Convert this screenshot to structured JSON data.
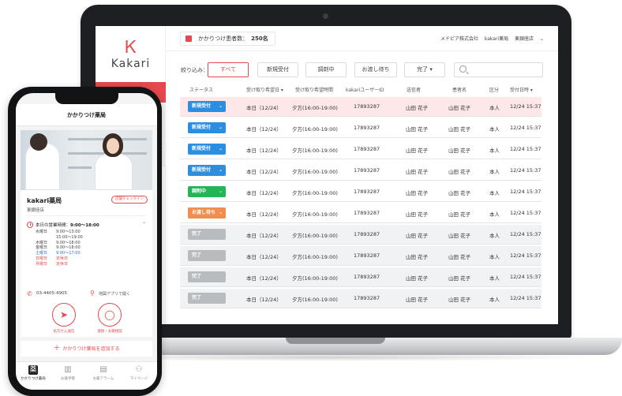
{
  "laptop": {
    "logo_text": "Kakari",
    "header": {
      "count_label": "かかりつけ患者数：",
      "count_value": "250名",
      "company": "メドピア株式会社",
      "store": "kakari薬局",
      "branch": "東銀座店",
      "branch_caret": "⌄"
    },
    "filter": {
      "label": "絞り込み：",
      "buttons": [
        "すべて",
        "新規受付",
        "調剤中",
        "お渡し待ち",
        "完了 ▾"
      ]
    },
    "table": {
      "headers": [
        "ステータス",
        "受け取り希望日 ▾",
        "受け取り希望時間",
        "kakariユーザーID",
        "送信者",
        "患者名",
        "区分",
        "受付日時 ▾"
      ],
      "rows": [
        {
          "status": "新規受付",
          "date": "本日（12/24）",
          "time": "夕方(16:00-19:00)",
          "id": "17893287",
          "sender": "山田 花子",
          "patient": "山田 花子",
          "kind": "本人",
          "received": "12/24 15:37"
        },
        {
          "status": "新規受付",
          "date": "本日（12/24）",
          "time": "夕方(16:00-19:00)",
          "id": "17893287",
          "sender": "山田 花子",
          "patient": "山田 花子",
          "kind": "本人",
          "received": "12/24 15:37"
        },
        {
          "status": "新規受付",
          "date": "本日（12/24）",
          "time": "夕方(16:00-19:00)",
          "id": "17893287",
          "sender": "山田 花子",
          "patient": "山田 花子",
          "kind": "本人",
          "received": "12/24 15:37"
        },
        {
          "status": "新規受付",
          "date": "本日（12/24）",
          "time": "夕方(16:00-19:00)",
          "id": "17893287",
          "sender": "山田 花子",
          "patient": "山田 花子",
          "kind": "本人",
          "received": "12/24 15:37"
        },
        {
          "status": "調剤中",
          "date": "本日（12/24）",
          "time": "夕方(16:00-19:00)",
          "id": "17893287",
          "sender": "山田 花子",
          "patient": "山田 花子",
          "kind": "本人",
          "received": "12/24 15:37"
        },
        {
          "status": "お渡し待ち",
          "date": "本日（12/24）",
          "time": "夕方(16:00-19:00)",
          "id": "17893287",
          "sender": "山田 花子",
          "patient": "山田 花子",
          "kind": "本人",
          "received": "12/24 15:37"
        },
        {
          "status": "完了",
          "date": "本日（12/24）",
          "time": "夕方(16:00-19:00)",
          "id": "17893287",
          "sender": "山田 花子",
          "patient": "山田 花子",
          "kind": "本人",
          "received": "12/24 15:37"
        },
        {
          "status": "完了",
          "date": "本日（12/24）",
          "time": "夕方(16:00-19:00)",
          "id": "17893287",
          "sender": "山田 花子",
          "patient": "山田 花子",
          "kind": "本人",
          "received": "12/24 15:37"
        },
        {
          "status": "完了",
          "date": "本日（12/24）",
          "time": "夕方(16:00-19:00)",
          "id": "17893287",
          "sender": "山田 花子",
          "patient": "山田 花子",
          "kind": "本人",
          "received": "12/24 15:37"
        },
        {
          "status": "完了",
          "date": "本日（12/24）",
          "time": "夕方(16:00-19:00)",
          "id": "17893287",
          "sender": "山田 花子",
          "patient": "山田 花子",
          "kind": "本人",
          "received": "12/24 15:37"
        }
      ]
    }
  },
  "phone": {
    "header_title": "かかりつけ薬局",
    "store_name": "kakari薬局",
    "branch": "東銀座店",
    "badge": "店舗チェックイン",
    "today_label": "本日の営業時間：",
    "today_hours": "9:00～18:00",
    "hours": [
      {
        "day": "水曜日",
        "time": "9:00～13:00",
        "style": "normal"
      },
      {
        "day": "",
        "time": "15:00～19:00",
        "style": "normal"
      },
      {
        "day": "木曜日",
        "time": "9:00～18:00",
        "style": "normal"
      },
      {
        "day": "金曜日",
        "time": "9:00～18:00",
        "style": "normal"
      },
      {
        "day": "土曜日",
        "time": "9:00～17:00",
        "style": "blue"
      },
      {
        "day": "日曜日",
        "time": "定休日",
        "style": "red"
      },
      {
        "day": "月曜日",
        "time": "定休日",
        "style": "red"
      }
    ],
    "phone_number": "03-4405-4905",
    "map_label": "地図アプリで開く",
    "action_send": "処方せん送信",
    "action_contact": "連絡・お薬相談",
    "add_store": "かかりつけ薬局を追加する",
    "tabs": [
      "かかりつけ薬局",
      "お薬手帳",
      "お薬アラーム",
      "マイページ"
    ],
    "tab_active_glyph": "薬"
  },
  "colors": {
    "accent": "#e5484d",
    "status_new": "#2b8ee0",
    "status_dispensing": "#22b455",
    "status_waiting": "#f08e4f",
    "status_done": "#b9bcbf"
  }
}
